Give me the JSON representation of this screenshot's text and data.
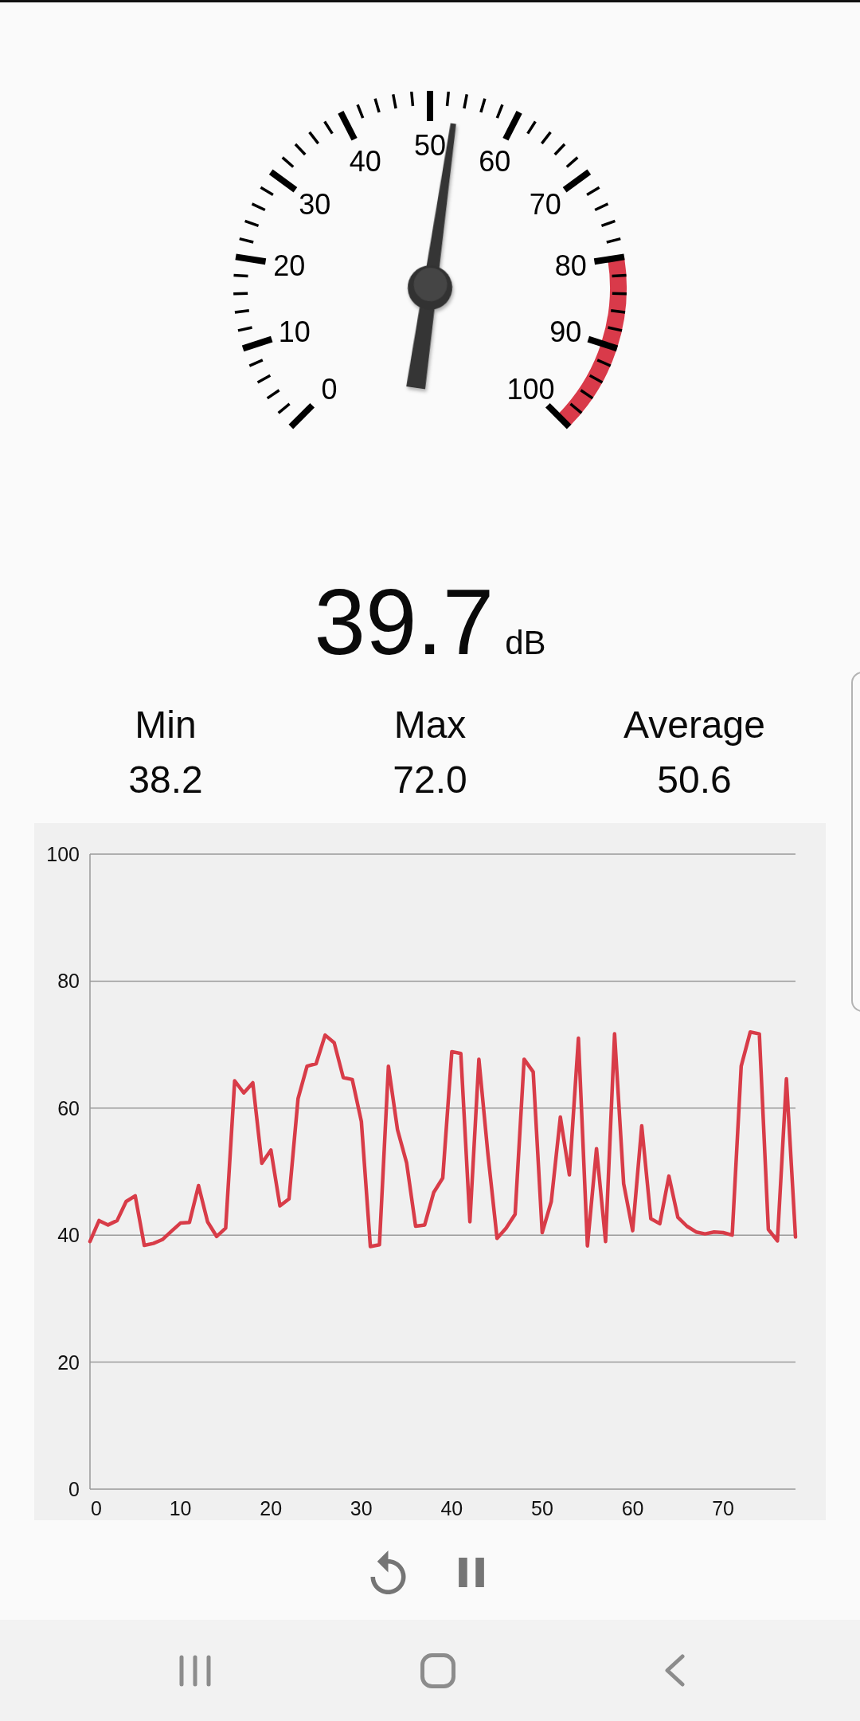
{
  "gauge": {
    "scale_labels": [
      "0",
      "10",
      "20",
      "30",
      "40",
      "50",
      "60",
      "70",
      "80",
      "90",
      "100"
    ],
    "needle": {
      "level": 0.53
    }
  },
  "reading": {
    "value": "39.7",
    "unit": "dB"
  },
  "stats": [
    {
      "label": "Min",
      "value": "38.2"
    },
    {
      "label": "Max",
      "value": "72.0"
    },
    {
      "label": "Average",
      "value": "50.6"
    }
  ],
  "chart": {
    "chart_data": {
      "type": "line",
      "grid": true,
      "x": [
        0,
        1,
        2,
        3,
        4,
        5,
        6,
        7,
        8,
        9,
        10,
        11,
        12,
        13,
        14,
        15,
        16,
        17,
        18,
        19,
        20,
        21,
        22,
        23,
        24,
        25,
        26,
        27,
        28,
        29,
        30,
        31,
        32,
        33,
        34,
        35,
        36,
        37,
        38,
        39,
        40,
        41,
        42,
        43,
        44,
        45,
        46,
        47,
        48,
        49,
        50,
        51,
        52,
        53,
        54,
        55,
        56,
        57,
        58,
        59,
        60,
        61,
        62,
        63,
        64,
        65,
        66,
        67,
        68,
        69,
        70,
        71,
        72,
        73,
        74,
        75,
        76,
        77,
        78
      ],
      "xlim": [
        0,
        78
      ],
      "ylim": [
        0,
        100
      ],
      "xticks": [
        0,
        10,
        20,
        30,
        40,
        50,
        60,
        70
      ],
      "yticks": [
        0,
        20,
        40,
        60,
        80,
        100
      ],
      "series": [
        {
          "color": "#d83c48",
          "values": [
            39.0,
            42.3,
            41.6,
            42.3,
            45.3,
            46.2,
            38.4,
            38.7,
            39.3,
            40.6,
            41.9,
            42.0,
            47.8,
            42.1,
            39.8,
            41.1,
            64.3,
            62.4,
            64.0,
            51.3,
            53.4,
            44.6,
            45.7,
            61.5,
            66.6,
            67.0,
            71.5,
            70.3,
            64.8,
            64.5,
            57.9,
            38.2,
            38.5,
            66.6,
            56.6,
            51.4,
            41.4,
            41.6,
            46.7,
            49.0,
            68.9,
            68.6,
            42.1,
            67.7,
            52.7,
            39.5,
            41.1,
            43.3,
            67.7,
            65.7,
            40.4,
            45.3,
            58.6,
            49.5,
            71.0,
            38.3,
            53.6,
            39.0,
            71.7,
            48.1,
            40.7,
            57.2,
            42.6,
            41.8,
            49.3,
            42.8,
            41.4,
            40.5,
            40.2,
            40.5,
            40.4,
            40.0,
            66.6,
            72.0,
            71.7,
            40.9,
            39.1,
            64.6,
            39.7
          ]
        }
      ]
    }
  },
  "controls": {
    "paused": false
  }
}
